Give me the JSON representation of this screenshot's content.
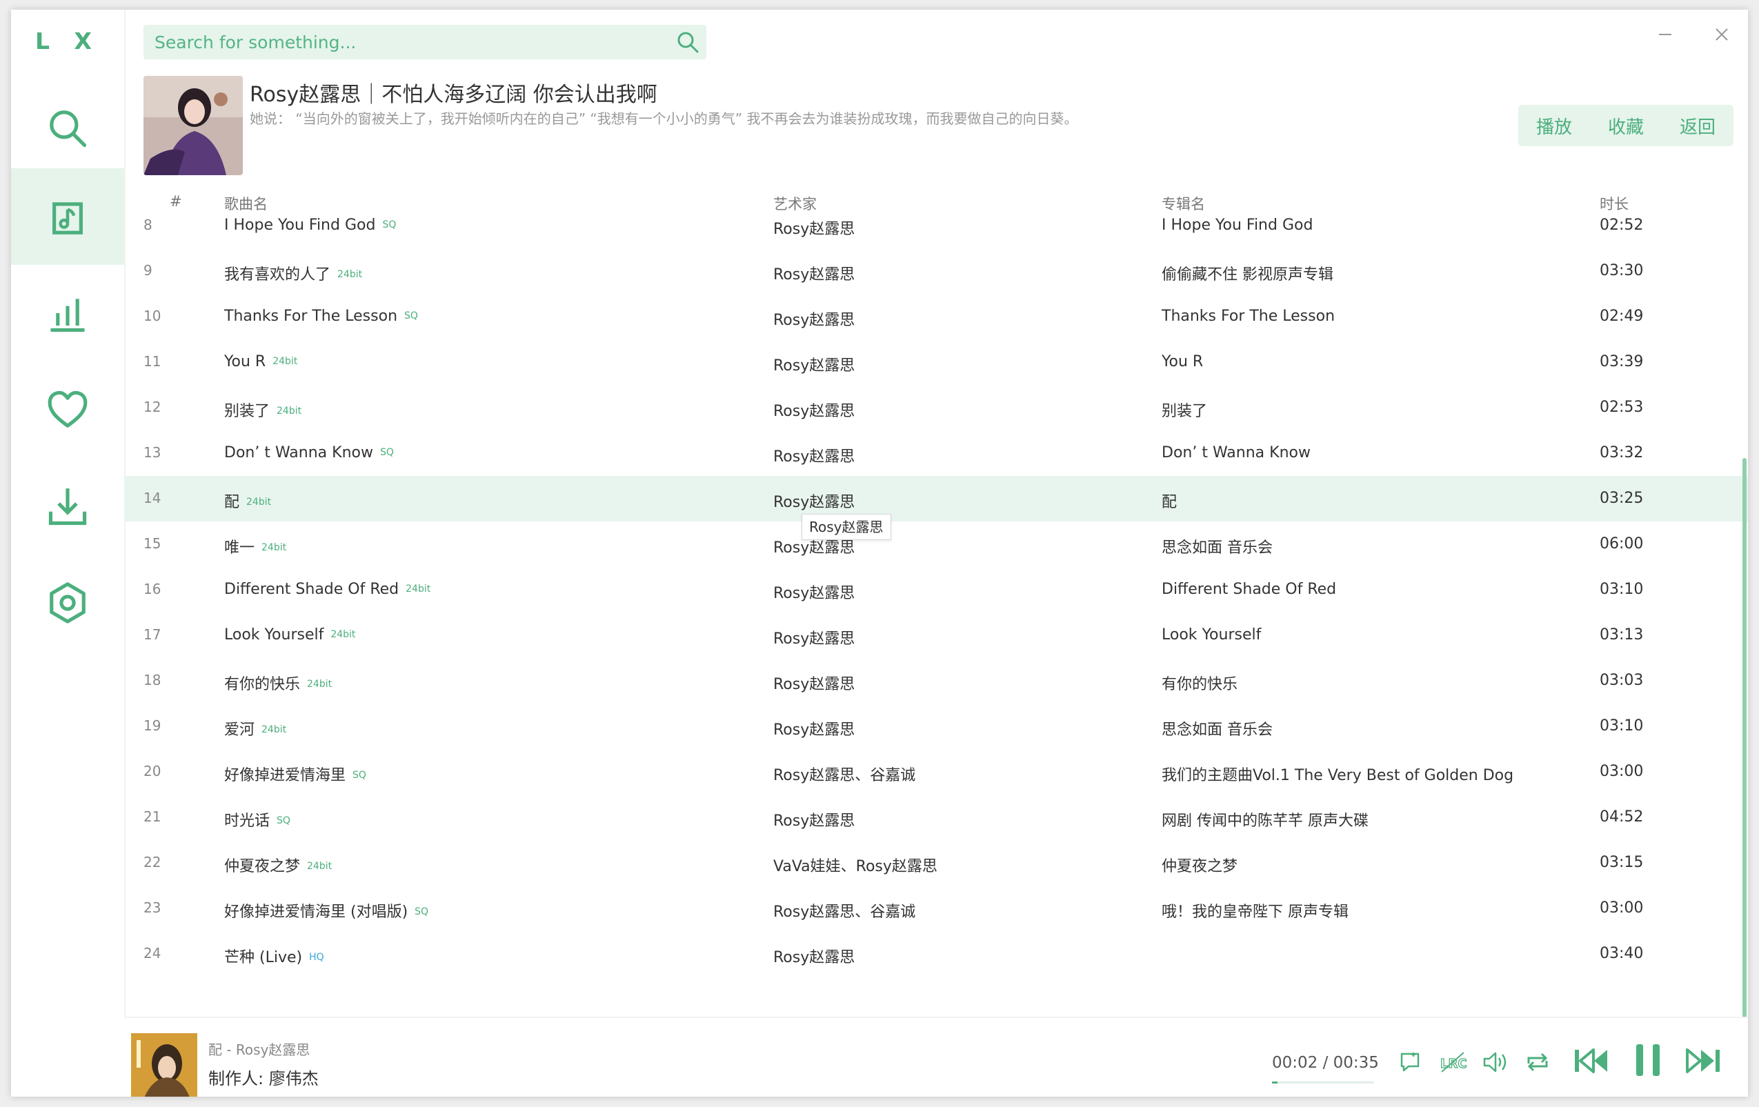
{
  "app": {
    "logo": "L X"
  },
  "colors": {
    "accent": "#4caf7d",
    "accent_light": "#e6f4ec",
    "row_highlight": "#e8f5ee"
  },
  "sidebar": {
    "items": [
      {
        "icon": "search-icon",
        "active": false
      },
      {
        "icon": "music-list-icon",
        "active": true
      },
      {
        "icon": "leaderboard-icon",
        "active": false
      },
      {
        "icon": "heart-icon",
        "active": false
      },
      {
        "icon": "download-icon",
        "active": false
      },
      {
        "icon": "settings-icon",
        "active": false
      }
    ]
  },
  "search": {
    "placeholder": "Search for something..."
  },
  "header": {
    "title": "Rosy赵露思｜不怕人海多辽阔 你会认出我啊",
    "description": "她说：  “当向外的窗被关上了，我开始倾听内在的自己”  “我想有一个小小的勇气”  我不再会去为谁装扮成玫瑰，而我要做自己的向日葵。",
    "buttons": {
      "play": "播放",
      "collect": "收藏",
      "back": "返回"
    }
  },
  "table": {
    "columns": {
      "num": "#",
      "name": "歌曲名",
      "artist": "艺术家",
      "album": "专辑名",
      "duration": "时长"
    },
    "rows": [
      {
        "num": "8",
        "name": "I Hope You Find God",
        "quality": "SQ",
        "artist": "Rosy赵露思",
        "album": "I Hope You Find God",
        "duration": "02:52"
      },
      {
        "num": "9",
        "name": "我有喜欢的人了",
        "quality": "24bit",
        "artist": "Rosy赵露思",
        "album": "偷偷藏不住 影视原声专辑",
        "duration": "03:30"
      },
      {
        "num": "10",
        "name": "Thanks For The Lesson",
        "quality": "SQ",
        "artist": "Rosy赵露思",
        "album": "Thanks For The Lesson",
        "duration": "02:49"
      },
      {
        "num": "11",
        "name": "You R",
        "quality": "24bit",
        "artist": "Rosy赵露思",
        "album": "You R",
        "duration": "03:39"
      },
      {
        "num": "12",
        "name": "别装了",
        "quality": "24bit",
        "artist": "Rosy赵露思",
        "album": "别装了",
        "duration": "02:53"
      },
      {
        "num": "13",
        "name": "Don’ t Wanna Know",
        "quality": "SQ",
        "artist": "Rosy赵露思",
        "album": "Don’ t Wanna Know",
        "duration": "03:32"
      },
      {
        "num": "14",
        "name": "配",
        "quality": "24bit",
        "artist": "Rosy赵露思",
        "album": "配",
        "duration": "03:25",
        "highlighted": true
      },
      {
        "num": "15",
        "name": "唯一",
        "quality": "24bit",
        "artist": "Rosy赵露思",
        "album": "思念如面 音乐会",
        "duration": "06:00"
      },
      {
        "num": "16",
        "name": "Different Shade Of Red",
        "quality": "24bit",
        "artist": "Rosy赵露思",
        "album": "Different Shade Of Red",
        "duration": "03:10"
      },
      {
        "num": "17",
        "name": "Look Yourself",
        "quality": "24bit",
        "artist": "Rosy赵露思",
        "album": "Look Yourself",
        "duration": "03:13"
      },
      {
        "num": "18",
        "name": "有你的快乐",
        "quality": "24bit",
        "artist": "Rosy赵露思",
        "album": "有你的快乐",
        "duration": "03:03"
      },
      {
        "num": "19",
        "name": "爱河",
        "quality": "24bit",
        "artist": "Rosy赵露思",
        "album": "思念如面 音乐会",
        "duration": "03:10"
      },
      {
        "num": "20",
        "name": "好像掉进爱情海里",
        "quality": "SQ",
        "artist": "Rosy赵露思、谷嘉诚",
        "album": "我们的主题曲Vol.1 The Very Best of Golden Dog",
        "duration": "03:00"
      },
      {
        "num": "21",
        "name": "时光话",
        "quality": "SQ",
        "artist": "Rosy赵露思",
        "album": "网剧 传闻中的陈芊芊 原声大碟",
        "duration": "04:52"
      },
      {
        "num": "22",
        "name": "仲夏夜之梦",
        "quality": "24bit",
        "artist": "VaVa娃娃、Rosy赵露思",
        "album": "仲夏夜之梦",
        "duration": "03:15"
      },
      {
        "num": "23",
        "name": "好像掉进爱情海里 (对唱版)",
        "quality": "SQ",
        "artist": "Rosy赵露思、谷嘉诚",
        "album": "哦！我的皇帝陛下 原声专辑",
        "duration": "03:00"
      },
      {
        "num": "24",
        "name": "芒种 (Live)",
        "quality": "HQ",
        "artist": "Rosy赵露思",
        "album": "",
        "duration": "03:40"
      }
    ]
  },
  "tooltip": {
    "text": "Rosy赵露思"
  },
  "player": {
    "song": "配 - Rosy赵露思",
    "lyric": "制作人: 廖伟杰",
    "time": "00:02 / 00:35",
    "progress": 0.057
  }
}
